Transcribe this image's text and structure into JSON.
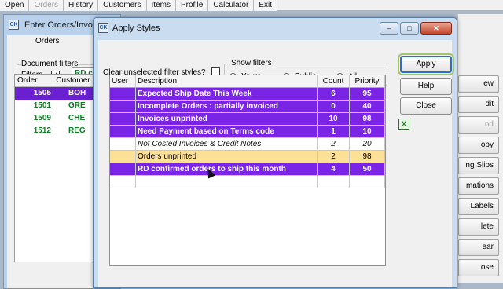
{
  "menubar": {
    "items": [
      {
        "label": "Open",
        "disabled": false
      },
      {
        "label": "Orders",
        "disabled": true
      },
      {
        "label": "History",
        "disabled": false
      },
      {
        "label": "Customers",
        "disabled": false
      },
      {
        "label": "Items",
        "disabled": false
      },
      {
        "label": "Profile",
        "disabled": false
      },
      {
        "label": "Calculator",
        "disabled": false
      },
      {
        "label": "Exit",
        "disabled": false
      }
    ]
  },
  "bg_window": {
    "title": "Enter Orders/Invoic",
    "tab_label": "Orders",
    "doc_filters_label": "Document filters",
    "filters_label": "Filters",
    "filters_checked": "✓",
    "filter_value": "RD co",
    "table": {
      "headers": [
        "Order",
        "Customer"
      ],
      "rows": [
        {
          "order": "1505",
          "customer": "BOH",
          "selected": true
        },
        {
          "order": "1501",
          "customer": "GRE",
          "selected": false
        },
        {
          "order": "1509",
          "customer": "CHE",
          "selected": false
        },
        {
          "order": "1512",
          "customer": "REG",
          "selected": false
        }
      ]
    },
    "right_buttons": [
      "ew",
      "dit",
      "nd",
      "opy",
      "ng Slips",
      "mations",
      "Labels",
      "lete",
      "ear",
      "ose"
    ]
  },
  "dialog": {
    "title": "Apply Styles",
    "clear_label": "Clear unselected filter styles?",
    "show_filters": {
      "legend": "Show filters",
      "options": [
        {
          "label": "Yours",
          "selected": false
        },
        {
          "label": "Public",
          "selected": true
        },
        {
          "label": "All",
          "selected": false
        }
      ]
    },
    "buttons": {
      "apply": "Apply",
      "help": "Help",
      "close": "Close"
    },
    "excel_icon": "X",
    "grid": {
      "headers": {
        "user": "User",
        "description": "Description",
        "count": "Count",
        "priority": "Priority"
      },
      "rows": [
        {
          "user": "",
          "description": "Expected Ship Date This Week",
          "count": "6",
          "priority": "95",
          "style": "purple"
        },
        {
          "user": "",
          "description": "Incomplete Orders : partially invoiced",
          "count": "0",
          "priority": "40",
          "style": "purple"
        },
        {
          "user": "",
          "description": "Invoices unprinted",
          "count": "10",
          "priority": "98",
          "style": "purple"
        },
        {
          "user": "",
          "description": "Need Payment based on Terms code",
          "count": "1",
          "priority": "10",
          "style": "purple"
        },
        {
          "user": "",
          "description": "Not Costed Invoices & Credit Notes",
          "count": "2",
          "priority": "20",
          "style": "italic"
        },
        {
          "user": "",
          "description": "Orders unprinted",
          "count": "2",
          "priority": "98",
          "style": "yellow"
        },
        {
          "user": "",
          "description": "RD confirmed orders to ship this month",
          "count": "4",
          "priority": "50",
          "style": "purple"
        },
        {
          "user": "",
          "description": "",
          "count": "",
          "priority": "",
          "style": "blank"
        }
      ]
    }
  },
  "colors": {
    "highlight_purple": "#7a25e6",
    "highlight_yellow": "#fde098",
    "green_text": "#0b7d20"
  }
}
